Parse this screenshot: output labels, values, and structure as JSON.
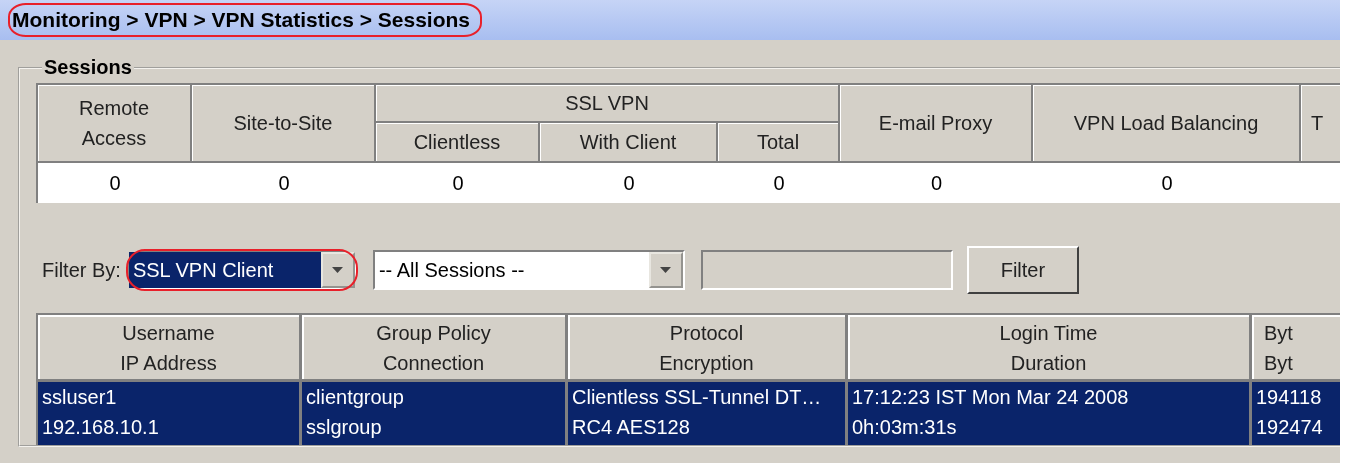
{
  "breadcrumb": {
    "text": "Monitoring > VPN > VPN Statistics > Sessions",
    "circled": true
  },
  "sessions_group": {
    "title": "Sessions",
    "summary": {
      "columns": [
        {
          "label": "Remote\nAccess"
        },
        {
          "label": "Site-to-Site"
        },
        {
          "label": "SSL VPN",
          "children": [
            {
              "label": "Clientless"
            },
            {
              "label": "With Client"
            },
            {
              "label": "Total"
            }
          ]
        },
        {
          "label": "E-mail Proxy"
        },
        {
          "label": "VPN Load Balancing"
        },
        {
          "label": "T"
        }
      ],
      "values": [
        "0",
        "0",
        "0",
        "0",
        "0",
        "0",
        "0"
      ]
    },
    "filter": {
      "label": "Filter By:",
      "type_dropdown": {
        "value": "SSL VPN Client",
        "focused": true,
        "circled": true
      },
      "scope_dropdown": {
        "value": "-- All Sessions --",
        "focused": false,
        "circled": false
      },
      "text_field": {
        "disabled": true
      },
      "button": "Filter"
    },
    "table": {
      "columns": [
        {
          "lines": [
            "Username",
            "IP Address"
          ]
        },
        {
          "lines": [
            "Group Policy",
            "Connection"
          ]
        },
        {
          "lines": [
            "Protocol",
            "Encryption"
          ]
        },
        {
          "lines": [
            "Login Time",
            "Duration"
          ]
        },
        {
          "lines": [
            "Byt",
            "Byt"
          ]
        }
      ],
      "rows": [
        {
          "selected": true,
          "cells": [
            [
              "ssluser1",
              "192.168.10.1"
            ],
            [
              "clientgroup",
              "sslgroup"
            ],
            [
              "Clientless SSL-Tunnel DT…",
              "RC4 AES128"
            ],
            [
              "17:12:23 IST Mon Mar 24 2008",
              "0h:03m:31s"
            ],
            [
              "194118",
              "192474"
            ]
          ]
        }
      ]
    }
  }
}
